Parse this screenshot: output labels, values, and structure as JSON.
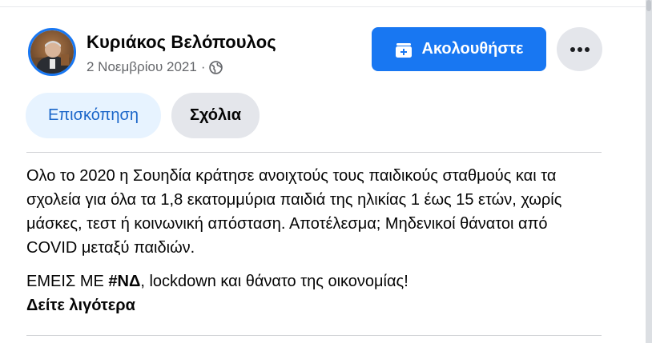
{
  "post": {
    "author": "Κυριάκος Βελόπουλος",
    "date": "2 Νοεμβρίου 2021",
    "separator": "·",
    "audience_icon": "globe-icon"
  },
  "actions": {
    "follow_label": "Ακολουθήστε",
    "follow_icon": "follow-page-icon",
    "more_icon": "more-options-icon"
  },
  "tabs": [
    {
      "label": "Επισκόπηση",
      "active": true
    },
    {
      "label": "Σχόλια",
      "active": false
    }
  ],
  "content": {
    "paragraph1": "Ολο το 2020 η Σουηδία κράτησε ανοιχτούς τους παιδικούς σταθμούς και τα σχολεία για όλα τα 1,8 εκατομμύρια παιδιά της ηλικίας 1 έως 15 ετών, χωρίς μάσκες, τεστ ή κοινωνική απόσταση. Αποτέλεσμα; Μηδενικοί θάνατοι από COVID μεταξύ παιδιών.",
    "paragraph2_prefix": "ΕΜΕΙΣ ΜΕ ",
    "hashtag": "#ΝΔ",
    "paragraph2_suffix": ", lockdown και θάνατο της οικονομίας!",
    "see_more": "Δείτε λιγότερα"
  },
  "colors": {
    "accent": "#1877f2",
    "tab_active_bg": "#e7f3ff",
    "tab_active_text": "#1b66c9",
    "secondary_bg": "#e4e6eb",
    "meta_text": "#65676b"
  }
}
